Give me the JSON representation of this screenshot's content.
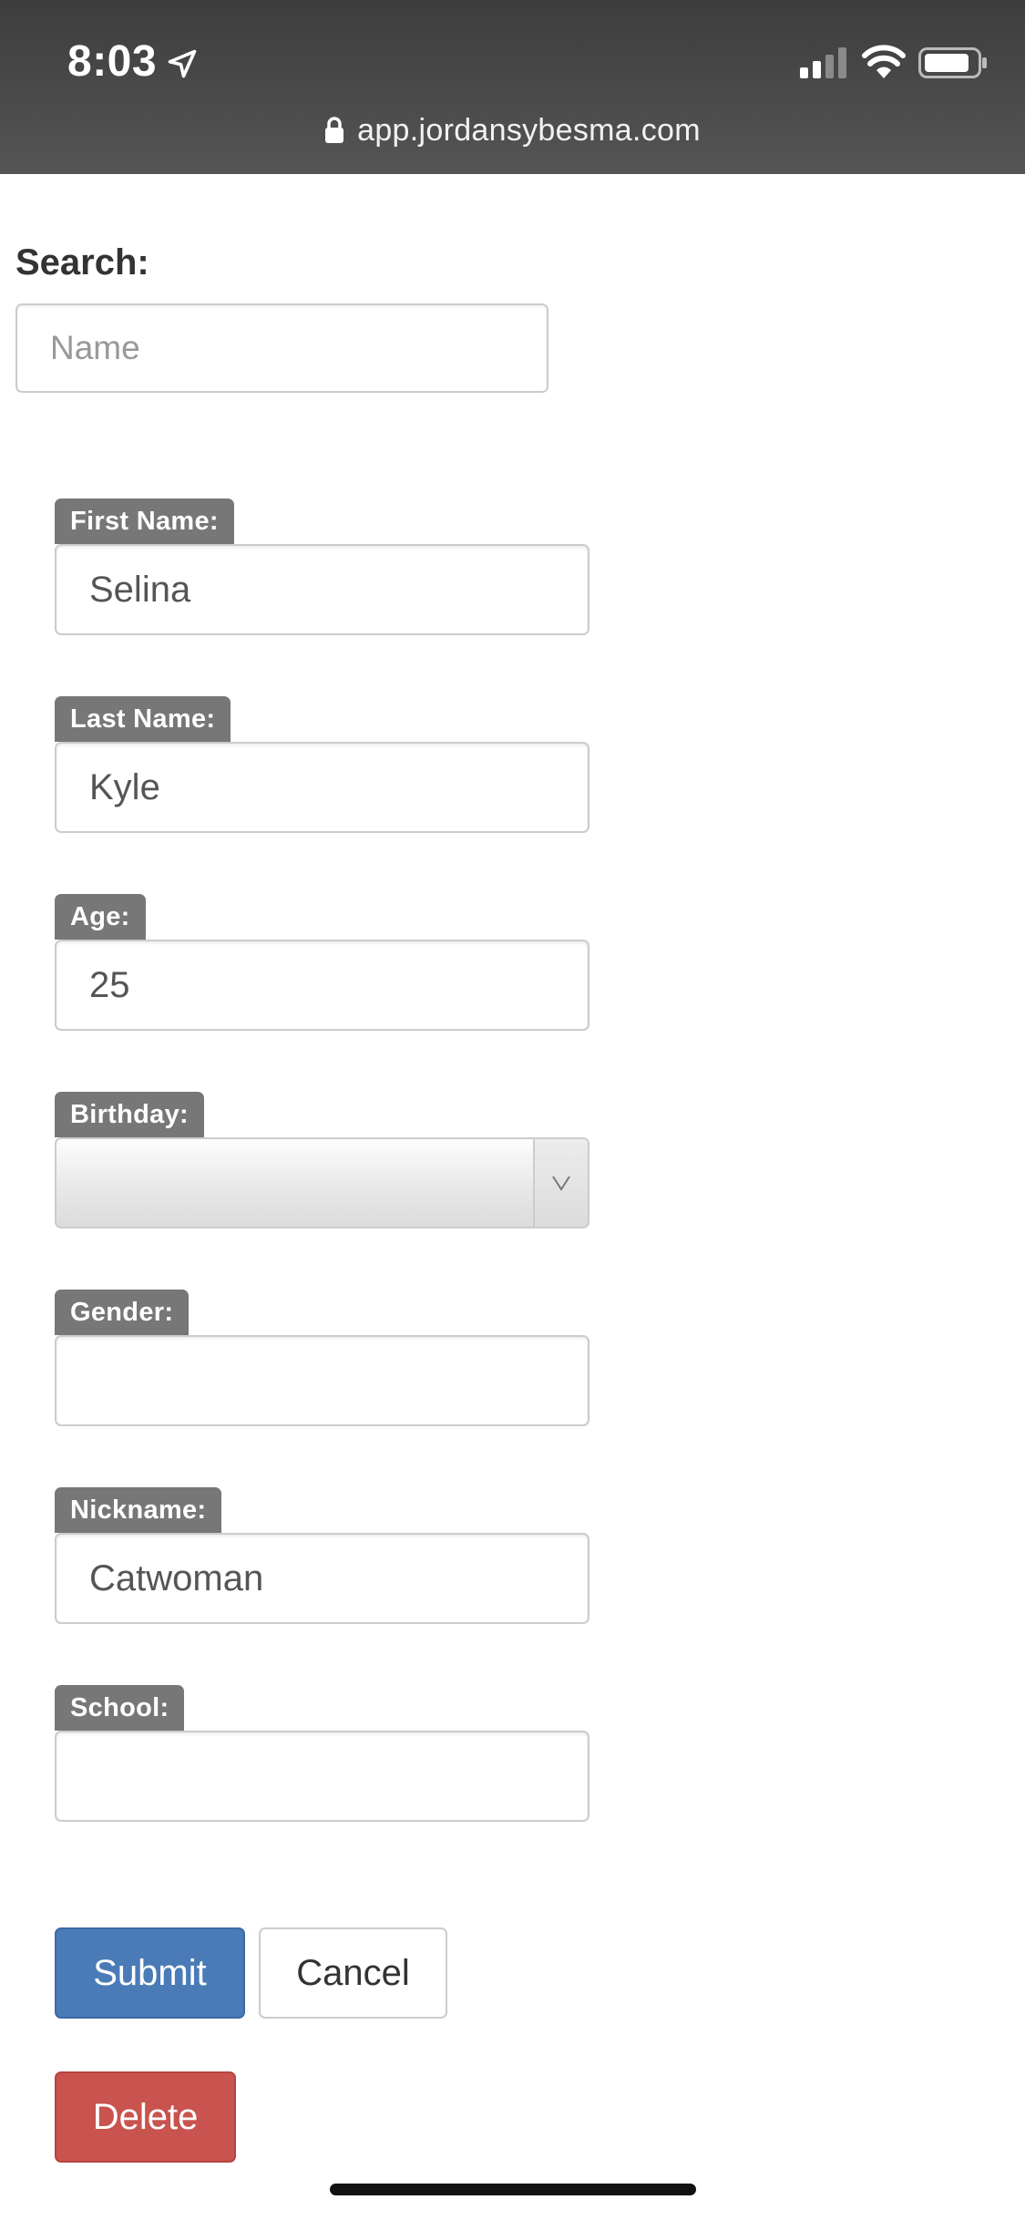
{
  "status_bar": {
    "time": "8:03",
    "icons": [
      "location-arrow-icon",
      "signal-icon",
      "wifi-icon",
      "battery-icon"
    ]
  },
  "address_bar": {
    "url": "app.jordansybesma.com",
    "icon": "lock-icon"
  },
  "search": {
    "label": "Search:",
    "placeholder": "Name",
    "value": ""
  },
  "form": {
    "first_name": {
      "label": "First Name:",
      "value": "Selina"
    },
    "last_name": {
      "label": "Last Name:",
      "value": "Kyle"
    },
    "age": {
      "label": "Age:",
      "value": "25"
    },
    "birthday": {
      "label": "Birthday:",
      "value": ""
    },
    "gender": {
      "label": "Gender:",
      "value": ""
    },
    "nickname": {
      "label": "Nickname:",
      "value": "Catwoman"
    },
    "school": {
      "label": "School:",
      "value": ""
    }
  },
  "buttons": {
    "submit": "Submit",
    "cancel": "Cancel",
    "delete": "Delete"
  },
  "colors": {
    "header_bg": "#4a4a4a",
    "label_bg": "#777777",
    "submit_bg": "#4a7bb7",
    "delete_bg": "#c9534f"
  }
}
